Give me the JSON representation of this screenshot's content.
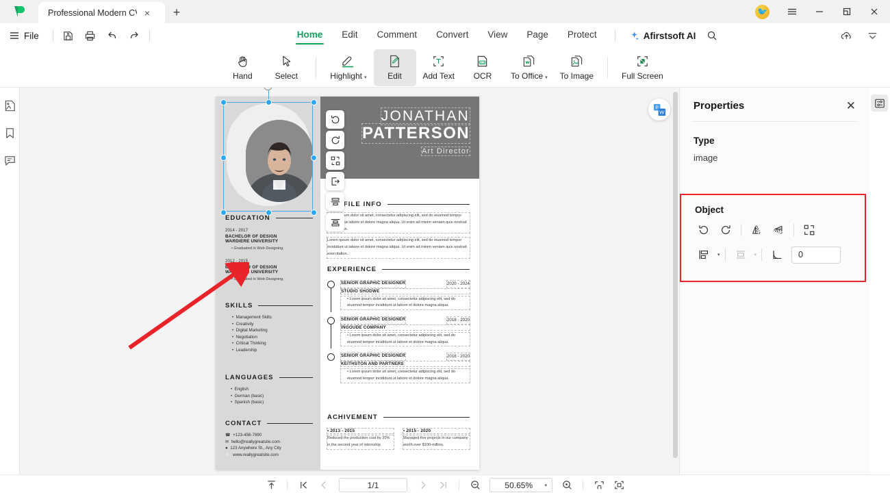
{
  "titlebar": {
    "tab_title": "Professional Modern CV...",
    "tab_close": "×",
    "new_tab": "+",
    "avatar_glyph": "🐦",
    "minimize": "–",
    "maximize": "❐",
    "close": "✕"
  },
  "menubar": {
    "file_label": "File",
    "items": [
      {
        "label": "Home",
        "active": true
      },
      {
        "label": "Edit",
        "active": false
      },
      {
        "label": "Comment",
        "active": false
      },
      {
        "label": "Convert",
        "active": false
      },
      {
        "label": "View",
        "active": false
      },
      {
        "label": "Page",
        "active": false
      },
      {
        "label": "Protect",
        "active": false
      }
    ],
    "ai_label": "Afirstsoft AI",
    "quick_actions": [
      "save-icon",
      "print-icon",
      "undo-icon",
      "redo-icon"
    ],
    "right_icons": [
      "cloud-upload-icon",
      "collapse-ribbon-icon"
    ],
    "search_icon": "search-icon"
  },
  "ribbon": {
    "tools": [
      {
        "label": "Hand",
        "icon": "hand-icon",
        "active": false,
        "dropdown": false
      },
      {
        "label": "Select",
        "icon": "cursor-icon",
        "active": false,
        "dropdown": false
      },
      {
        "label": "Highlight",
        "icon": "highlight-icon",
        "active": false,
        "dropdown": true
      },
      {
        "label": "Edit",
        "icon": "edit-pencil-icon",
        "active": true,
        "dropdown": false
      },
      {
        "label": "Add Text",
        "icon": "add-text-icon",
        "active": false,
        "dropdown": false
      },
      {
        "label": "OCR",
        "icon": "ocr-icon",
        "active": false,
        "dropdown": false
      },
      {
        "label": "To Office",
        "icon": "to-office-icon",
        "active": false,
        "dropdown": true
      },
      {
        "label": "To Image",
        "icon": "to-image-icon",
        "active": false,
        "dropdown": false
      },
      {
        "label": "Full Screen",
        "icon": "full-screen-icon",
        "active": false,
        "dropdown": false
      }
    ],
    "caret": "▾"
  },
  "left_rail": {
    "items": [
      "thumbnail-icon",
      "bookmark-icon",
      "comment-icon"
    ]
  },
  "floating_toolbar": {
    "items": [
      "rotate-left-icon",
      "rotate-right-icon",
      "arrange-icon",
      "extract-icon",
      "align-center-icon",
      "align-middle-icon"
    ]
  },
  "document": {
    "name_first": "JONATHAN",
    "name_last": "PATTERSON",
    "role": "Art Director",
    "education": {
      "title": "EDUCATION",
      "entries": [
        {
          "years": "2014 - 2017",
          "degree": "BACHELOR OF DESIGN",
          "school": "WARDIERE UNIVERSITY",
          "note": "Graduated in Web Designing."
        },
        {
          "years": "2012 - 2015",
          "degree": "BACHELOR OF DESIGN",
          "school": "WARDIERE UNIVERSITY",
          "note": "Graduated in Web Designing."
        }
      ]
    },
    "skills": {
      "title": "SKILLS",
      "items": [
        "Management Skills",
        "Creativity",
        "Digital Marketing",
        "Negotiation",
        "Critical Thinking",
        "Leadership"
      ]
    },
    "languages": {
      "title": "LANGUAGES",
      "items": [
        "English",
        "German (basic)",
        "Spanish (basic)"
      ]
    },
    "contact": {
      "title": "CONTACT",
      "phone": "+123-456-7890",
      "email": "hello@reallygreatsite.com",
      "address": "123 Anywhere St., Any City",
      "website": "www.reallygreatsite.com"
    },
    "profile": {
      "title": "PROFILE INFO",
      "paragraph1": "Lorem ipsum dolor sit amet, consectetur adipiscing elit, sed do eiusmod tempor incididunt ut labore et dolore magna aliqua. Ut enim ad minim veniam quis nostrud exercitation.",
      "paragraph2": "Lorem ipsum dolor sit amet, consectetur adipiscing elit, sed do eiusmod tempor incididunt ut labore et dolore magna aliqua. Ut enim ad minim veniam quis nostrud exercitation."
    },
    "experience": {
      "title": "EXPERIENCE",
      "entries": [
        {
          "role": "SENIOR GRAPHIC DESIGNER",
          "company": "STUDIO SHODWE",
          "years": "2020 - 2024",
          "bullet": "Lorem ipsum dolor sit amet, consectetur adipiscing elit, sed do eiusmod tempor incididunt ut labore et dolore magna aliqua."
        },
        {
          "role": "SENIOR GRAPHIC DESIGNER",
          "company": "INGOUDE COMPANY",
          "years": "2018 - 2020",
          "bullet": "Lorem ipsum dolor sit amet, consectetur adipiscing elit, sed do eiusmod tempor incididunt ut labore et dolore magna aliqua."
        },
        {
          "role": "SENIOR GRAPHIC DESIGNER",
          "company": "KEITHSTON AND PARTNERS",
          "years": "2018 - 2020",
          "bullet": "Lorem ipsum dolor sit amet, consectetur adipiscing elit, sed do eiusmod tempor incididunt ut labore et dolore magna aliqua."
        }
      ]
    },
    "achievement": {
      "title": "ACHIVEMENT",
      "entries": [
        {
          "years": "2013 - 2015",
          "text": "Reduced the production cost by 20% in the second year of internship"
        },
        {
          "years": "2015 - 2020",
          "text": "Managed five projects in our company worth over $100-million."
        }
      ]
    }
  },
  "properties": {
    "title": "Properties",
    "close": "✕",
    "type_label": "Type",
    "type_value": "image",
    "object_label": "Object",
    "object_icons": [
      "rotate-left-icon",
      "rotate-right-icon",
      "flip-horizontal-icon",
      "flip-vertical-icon",
      "arrange-icon"
    ],
    "align_icon": "align-left-icon",
    "distribute_icon": "distribute-icon",
    "angle_icon": "angle-icon",
    "angle_value": "0",
    "highlight_color": "#e8232a",
    "caret": "▾"
  },
  "statusbar": {
    "page_value": "1/1",
    "zoom_value": "50.65%",
    "zoom_caret": "▾",
    "icons": [
      "fit-top-icon",
      "first-page-icon",
      "prev-page-icon",
      "next-page-icon",
      "last-page-icon",
      "zoom-out-icon",
      "zoom-in-icon",
      "fit-width-icon",
      "fit-page-icon"
    ]
  },
  "theme": {
    "accent_green": "#17a05e",
    "selection_blue": "#2da7ef",
    "annotation_red": "#e8232a"
  }
}
